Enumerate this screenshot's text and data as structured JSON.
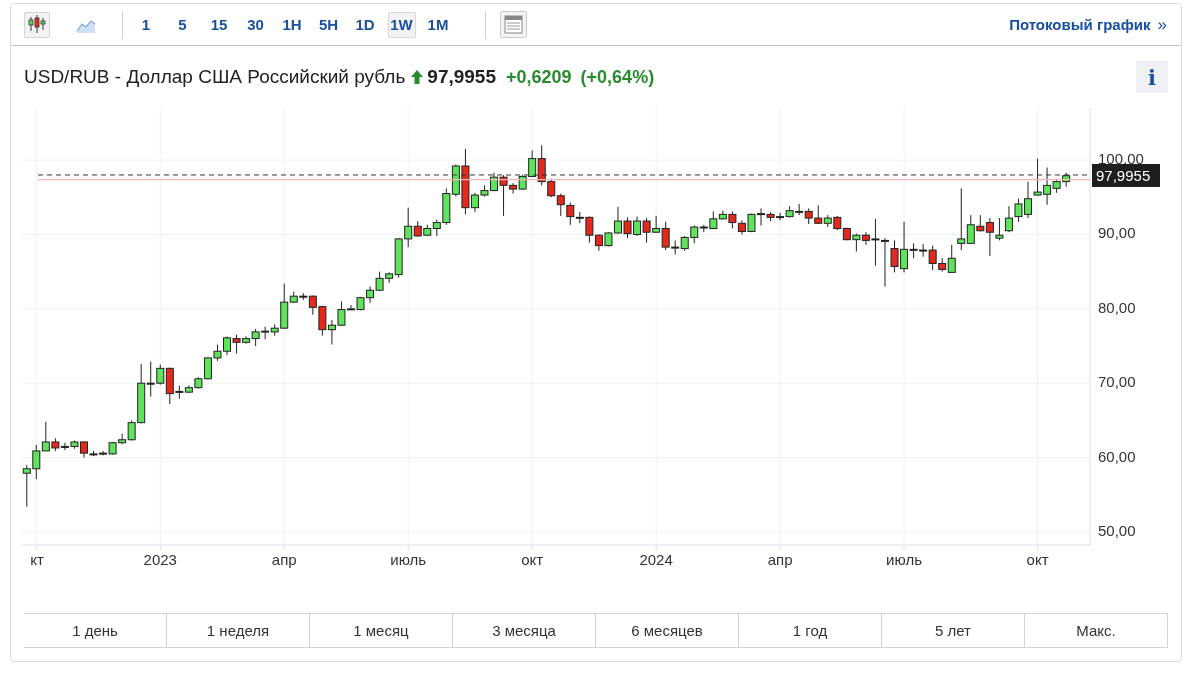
{
  "toolbar": {
    "chart_types": [
      {
        "kind": "candles",
        "selected": true
      },
      {
        "kind": "area",
        "selected": false
      }
    ],
    "intervals": [
      {
        "label": "1",
        "selected": false
      },
      {
        "label": "5",
        "selected": false
      },
      {
        "label": "15",
        "selected": false
      },
      {
        "label": "30",
        "selected": false
      },
      {
        "label": "1H",
        "selected": false
      },
      {
        "label": "5H",
        "selected": false
      },
      {
        "label": "1D",
        "selected": false
      },
      {
        "label": "1W",
        "selected": true
      },
      {
        "label": "1M",
        "selected": false
      }
    ],
    "streaming_link": "Потоковый график",
    "streaming_link_icon": "»"
  },
  "quote": {
    "title": "USD/RUB - Доллар США Российский рубль",
    "rising": true,
    "price": "97,9955",
    "change": "+0,6209",
    "change_percent": "(+0,64%)",
    "info_label": "i"
  },
  "chart": {
    "chart_data": {
      "type": "candlestick",
      "ylim": [
        48.25,
        107.0
      ],
      "grid": true,
      "categories": [
        null,
        "кт",
        null,
        null,
        null,
        null,
        null,
        null,
        null,
        null,
        null,
        null,
        null,
        null,
        "2023",
        null,
        null,
        null,
        null,
        null,
        null,
        null,
        null,
        null,
        null,
        null,
        null,
        "апр",
        null,
        null,
        null,
        null,
        null,
        null,
        null,
        null,
        null,
        null,
        null,
        null,
        "июль",
        null,
        null,
        null,
        null,
        null,
        null,
        null,
        null,
        null,
        null,
        null,
        null,
        "окт",
        null,
        null,
        null,
        null,
        null,
        null,
        null,
        null,
        null,
        null,
        null,
        null,
        "2024",
        null,
        null,
        null,
        null,
        null,
        null,
        null,
        null,
        null,
        null,
        null,
        null,
        "апр",
        null,
        null,
        null,
        null,
        null,
        null,
        null,
        null,
        null,
        null,
        null,
        null,
        "июль",
        null,
        null,
        null,
        null,
        null,
        null,
        null,
        null,
        null,
        null,
        null,
        null,
        null,
        "окт",
        null,
        null,
        null,
        null,
        null
      ],
      "yticks": [
        {
          "value": 50,
          "label": "50,00"
        },
        {
          "value": 60,
          "label": "60,00"
        },
        {
          "value": 70,
          "label": "70,00"
        },
        {
          "value": 80,
          "label": "80,00"
        },
        {
          "value": 90,
          "label": "90,00"
        },
        {
          "value": 100,
          "label": "100,00"
        }
      ],
      "ohlc": [
        [
          57.9,
          59.0,
          53.4,
          58.5
        ],
        [
          58.5,
          61.7,
          57.1,
          60.9
        ],
        [
          60.9,
          64.8,
          60.9,
          62.1
        ],
        [
          62.1,
          62.6,
          60.9,
          61.3
        ],
        [
          61.4,
          62.0,
          61.0,
          61.5
        ],
        [
          61.5,
          62.3,
          61.2,
          62.1
        ],
        [
          62.1,
          62.2,
          60.0,
          60.6
        ],
        [
          60.5,
          60.9,
          60.2,
          60.5
        ],
        [
          60.5,
          60.9,
          60.3,
          60.6
        ],
        [
          60.5,
          62.1,
          60.4,
          62.0
        ],
        [
          62.0,
          63.2,
          61.8,
          62.4
        ],
        [
          62.4,
          65.0,
          62.3,
          64.7
        ],
        [
          64.7,
          72.6,
          64.6,
          70.0
        ],
        [
          70.0,
          72.9,
          68.2,
          70.0
        ],
        [
          70.0,
          72.5,
          69.8,
          72.0
        ],
        [
          72.0,
          72.1,
          67.2,
          68.6
        ],
        [
          68.9,
          69.7,
          67.9,
          68.9
        ],
        [
          68.8,
          69.7,
          68.7,
          69.4
        ],
        [
          69.4,
          70.8,
          69.3,
          70.6
        ],
        [
          70.6,
          73.5,
          70.5,
          73.4
        ],
        [
          73.4,
          75.2,
          73.0,
          74.3
        ],
        [
          74.3,
          76.3,
          73.8,
          76.1
        ],
        [
          76.0,
          76.5,
          74.0,
          75.5
        ],
        [
          75.5,
          76.3,
          75.3,
          76.0
        ],
        [
          76.0,
          77.3,
          75.0,
          76.9
        ],
        [
          76.9,
          77.6,
          75.9,
          77.0
        ],
        [
          76.9,
          77.9,
          76.4,
          77.4
        ],
        [
          77.4,
          83.4,
          77.3,
          80.9
        ],
        [
          80.9,
          82.3,
          80.8,
          81.7
        ],
        [
          81.7,
          82.1,
          81.2,
          81.7
        ],
        [
          81.7,
          81.8,
          79.2,
          80.2
        ],
        [
          80.3,
          80.4,
          76.4,
          77.2
        ],
        [
          77.2,
          78.5,
          75.2,
          77.8
        ],
        [
          77.8,
          81.0,
          77.7,
          79.9
        ],
        [
          80.0,
          80.5,
          79.8,
          80.0
        ],
        [
          79.9,
          81.6,
          79.8,
          81.5
        ],
        [
          81.5,
          83.0,
          80.8,
          82.5
        ],
        [
          82.5,
          85.0,
          82.4,
          84.1
        ],
        [
          84.1,
          84.9,
          83.5,
          84.7
        ],
        [
          84.6,
          89.5,
          84.2,
          89.4
        ],
        [
          89.4,
          93.6,
          88.3,
          91.1
        ],
        [
          91.1,
          91.8,
          89.7,
          89.8
        ],
        [
          89.9,
          91.3,
          89.8,
          90.8
        ],
        [
          90.8,
          92.0,
          89.8,
          91.6
        ],
        [
          91.6,
          96.2,
          91.3,
          95.5
        ],
        [
          95.4,
          99.4,
          95.1,
          99.2
        ],
        [
          99.2,
          101.5,
          92.7,
          93.6
        ],
        [
          93.6,
          95.6,
          93.0,
          95.3
        ],
        [
          95.3,
          96.6,
          95.1,
          95.9
        ],
        [
          95.9,
          98.3,
          95.8,
          97.7
        ],
        [
          97.7,
          98.0,
          92.5,
          96.6
        ],
        [
          96.6,
          96.9,
          95.5,
          96.1
        ],
        [
          96.1,
          98.0,
          96.0,
          97.8
        ],
        [
          97.8,
          101.3,
          97.7,
          100.2
        ],
        [
          100.2,
          102.0,
          96.6,
          97.1
        ],
        [
          97.1,
          97.5,
          95.0,
          95.2
        ],
        [
          95.2,
          95.5,
          92.5,
          94.0
        ],
        [
          93.9,
          94.3,
          91.3,
          92.4
        ],
        [
          92.3,
          93.0,
          91.5,
          92.3
        ],
        [
          92.3,
          92.4,
          88.9,
          89.9
        ],
        [
          89.9,
          90.0,
          87.8,
          88.5
        ],
        [
          88.5,
          90.3,
          88.4,
          90.2
        ],
        [
          90.2,
          93.7,
          90.1,
          91.8
        ],
        [
          91.8,
          92.3,
          89.5,
          90.1
        ],
        [
          90.0,
          92.4,
          89.8,
          91.8
        ],
        [
          91.8,
          92.2,
          88.9,
          90.3
        ],
        [
          90.3,
          92.5,
          90.2,
          90.8
        ],
        [
          90.8,
          91.7,
          87.9,
          88.3
        ],
        [
          88.3,
          89.2,
          87.3,
          88.2
        ],
        [
          88.1,
          89.8,
          87.8,
          89.6
        ],
        [
          89.6,
          91.2,
          88.8,
          91.0
        ],
        [
          91.0,
          91.3,
          90.3,
          90.9
        ],
        [
          90.8,
          93.1,
          90.7,
          92.1
        ],
        [
          92.1,
          93.2,
          92.0,
          92.7
        ],
        [
          92.7,
          93.1,
          90.8,
          91.6
        ],
        [
          91.5,
          91.9,
          90.0,
          90.4
        ],
        [
          90.4,
          92.8,
          90.3,
          92.7
        ],
        [
          92.8,
          93.5,
          91.2,
          92.8
        ],
        [
          92.7,
          93.0,
          91.8,
          92.3
        ],
        [
          92.4,
          92.9,
          91.9,
          92.4
        ],
        [
          92.4,
          93.8,
          92.3,
          93.2
        ],
        [
          93.1,
          94.1,
          92.6,
          93.1
        ],
        [
          93.1,
          93.5,
          91.4,
          92.2
        ],
        [
          92.2,
          93.9,
          91.4,
          91.5
        ],
        [
          91.5,
          92.6,
          91.0,
          92.2
        ],
        [
          92.3,
          92.5,
          90.6,
          90.8
        ],
        [
          90.8,
          90.9,
          89.2,
          89.3
        ],
        [
          89.3,
          90.1,
          87.7,
          89.9
        ],
        [
          89.9,
          90.3,
          88.6,
          89.2
        ],
        [
          89.4,
          92.1,
          85.8,
          89.4
        ],
        [
          89.2,
          89.5,
          83.0,
          89.2
        ],
        [
          88.1,
          89.2,
          84.9,
          85.7
        ],
        [
          85.4,
          91.7,
          84.9,
          88.0
        ],
        [
          88.0,
          88.8,
          86.8,
          88.0
        ],
        [
          87.9,
          88.7,
          87.0,
          87.9
        ],
        [
          87.9,
          88.5,
          85.2,
          86.1
        ],
        [
          86.1,
          86.8,
          85.0,
          85.3
        ],
        [
          84.9,
          88.6,
          84.9,
          86.8
        ],
        [
          88.8,
          96.2,
          87.9,
          89.4
        ],
        [
          88.8,
          92.6,
          88.8,
          91.3
        ],
        [
          91.1,
          92.6,
          90.4,
          90.5
        ],
        [
          91.6,
          92.2,
          87.1,
          90.3
        ],
        [
          89.5,
          92.2,
          89.2,
          89.9
        ],
        [
          90.5,
          93.8,
          90.3,
          92.2
        ],
        [
          92.4,
          94.8,
          91.7,
          94.1
        ],
        [
          92.7,
          97.1,
          92.2,
          94.8
        ],
        [
          95.3,
          100.2,
          95.2,
          95.7
        ],
        [
          95.4,
          99.0,
          94.0,
          96.6
        ],
        [
          96.2,
          97.3,
          95.6,
          97.1
        ],
        [
          97.1,
          98.3,
          96.4,
          97.9
        ],
        null,
        null
      ],
      "ref_lines": [
        {
          "axis": "y",
          "value": 97.9955,
          "label": "97,9955"
        },
        {
          "axis": "y",
          "value": 97.3746,
          "color": "#f4b4b4"
        }
      ]
    }
  },
  "ranges": [
    {
      "label": "1 день",
      "selected": false
    },
    {
      "label": "1 неделя",
      "selected": false
    },
    {
      "label": "1 месяц",
      "selected": false
    },
    {
      "label": "3 месяца",
      "selected": false
    },
    {
      "label": "6 месяцев",
      "selected": false
    },
    {
      "label": "1 год",
      "selected": false
    },
    {
      "label": "5 лет",
      "selected": false
    },
    {
      "label": "Макс.",
      "selected": false
    }
  ]
}
